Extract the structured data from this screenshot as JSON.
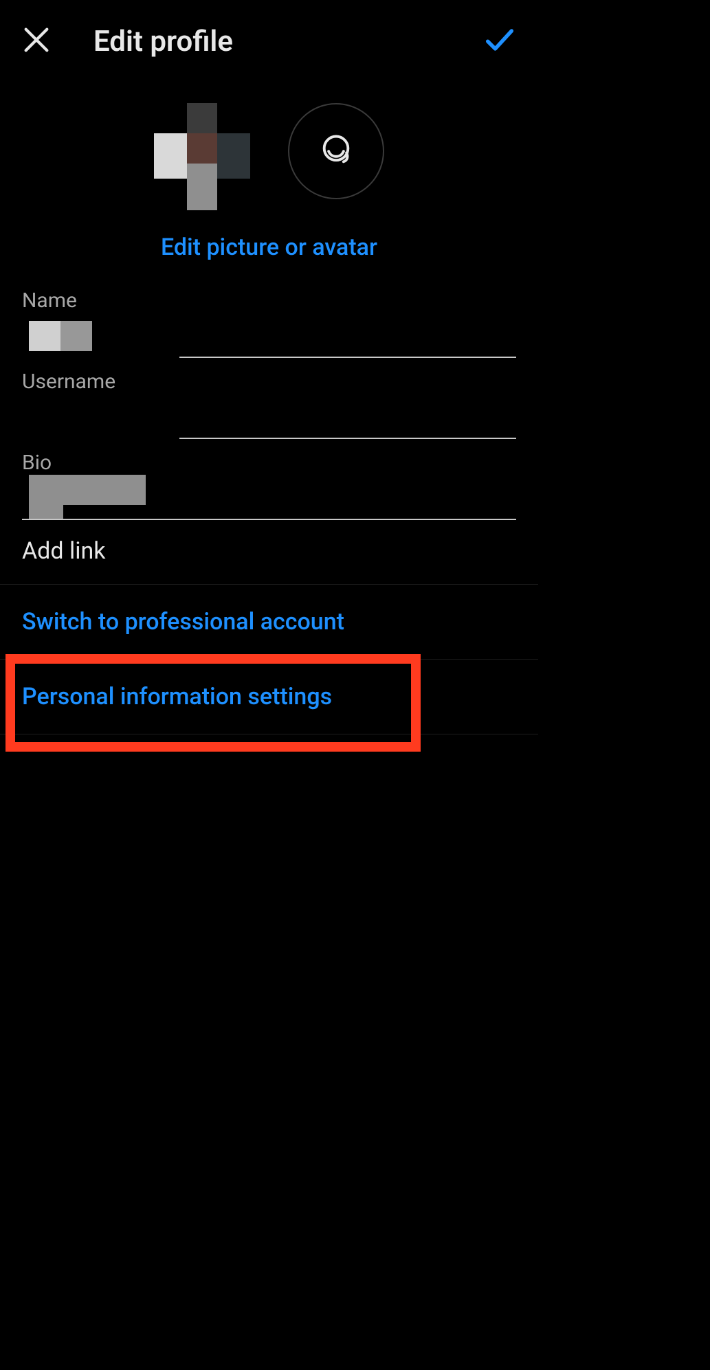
{
  "header": {
    "title": "Edit profile"
  },
  "avatar_section": {
    "edit_link": "Edit picture or avatar"
  },
  "fields": {
    "name": {
      "label": "Name",
      "value": ""
    },
    "username": {
      "label": "Username",
      "value": ""
    },
    "bio": {
      "label": "Bio",
      "value": ""
    }
  },
  "add_link_label": "Add link",
  "links": {
    "switch_professional": "Switch to professional account",
    "personal_info": "Personal information settings"
  }
}
